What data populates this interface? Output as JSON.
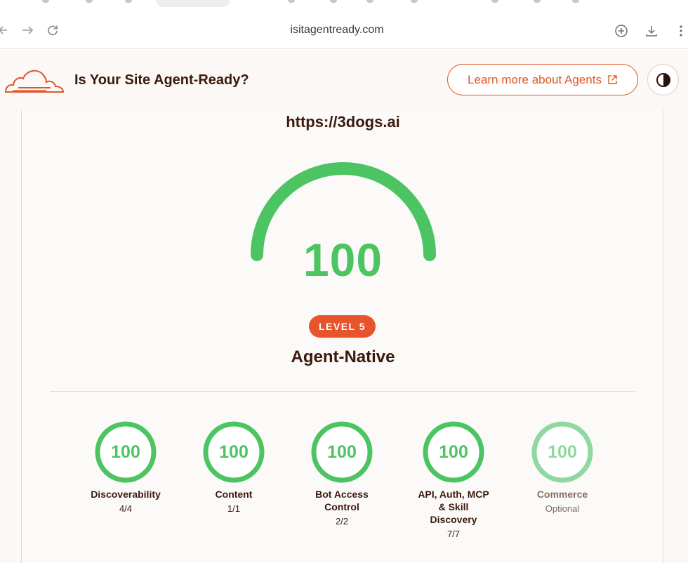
{
  "browser": {
    "url": "isitagentready.com"
  },
  "header": {
    "title": "Is Your Site Agent-Ready?",
    "learn_more": "Learn more about Agents"
  },
  "result": {
    "site_url": "https://3dogs.ai",
    "score": "100",
    "score_fraction": 1.0,
    "level_badge": "LEVEL 5",
    "level_name": "Agent-Native"
  },
  "categories": [
    {
      "score": "100",
      "label": "Discoverability",
      "detail": "4/4",
      "fraction": 1.0
    },
    {
      "score": "100",
      "label": "Content",
      "detail": "1/1",
      "fraction": 1.0
    },
    {
      "score": "100",
      "label": "Bot Access Control",
      "detail": "2/2",
      "fraction": 1.0
    },
    {
      "score": "100",
      "label": "API, Auth, MCP & Skill Discovery",
      "detail": "7/7",
      "fraction": 1.0
    },
    {
      "score": "100",
      "label": "Commerce",
      "detail": "Optional",
      "fraction": 1.0
    }
  ],
  "colors": {
    "accent": "#e0562b",
    "success": "#4cc462",
    "success_muted": "#8fd8a0",
    "text_dark": "#3b1a0e"
  },
  "icons": {
    "back": "arrow-left-icon",
    "forward": "arrow-right-icon",
    "reload": "reload-icon",
    "add": "plus-circle-icon",
    "download": "download-icon",
    "menu": "kebab-menu-icon",
    "logo": "cloud-logo",
    "external": "external-link-icon",
    "theme": "contrast-icon"
  }
}
